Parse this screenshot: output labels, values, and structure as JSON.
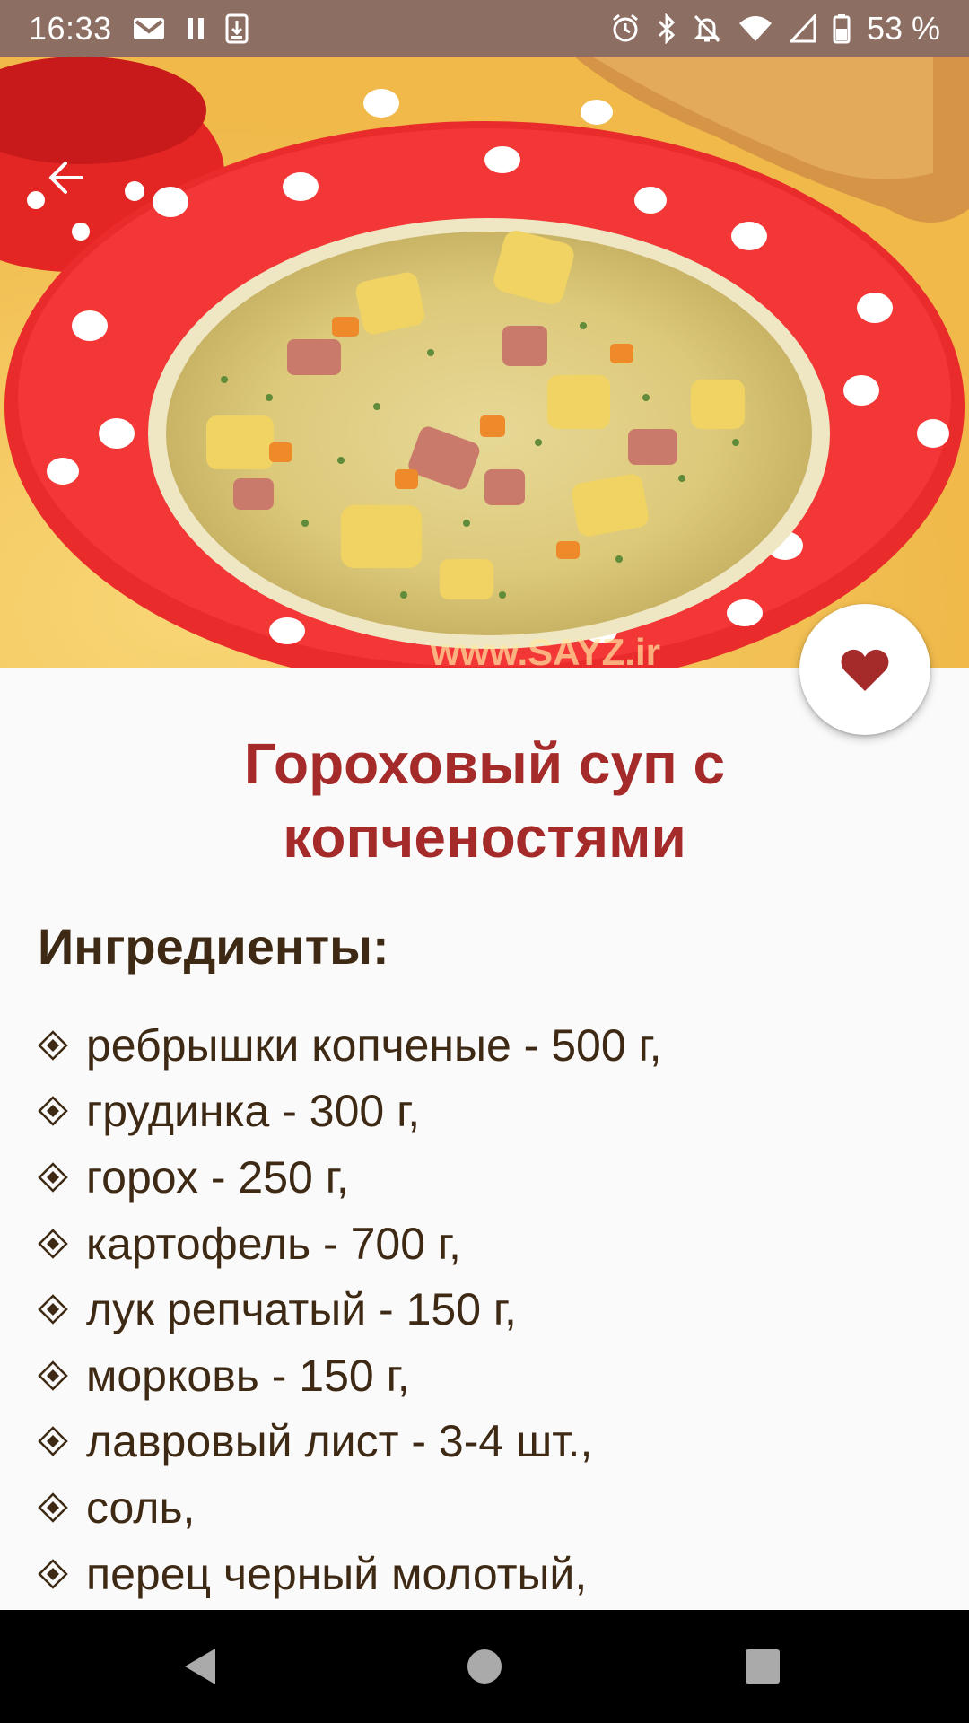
{
  "status_bar": {
    "time": "16:33",
    "battery_percent": "53 %",
    "icons": [
      "gmail-icon",
      "pause-icon",
      "download-icon",
      "alarm-icon",
      "bluetooth-icon",
      "dnd-off-icon",
      "wifi-icon",
      "signal-icon",
      "battery-icon"
    ]
  },
  "hero": {
    "image_description_icon": "pea-soup-photo",
    "back_icon": "arrow-back-icon",
    "watermark": "www.SAYZ.ir"
  },
  "favorite": {
    "icon": "heart-icon",
    "color": "#a52a2a"
  },
  "recipe": {
    "title": "Гороховый суп с копченостями",
    "ingredients_heading": "Ингредиенты:",
    "ingredients": [
      "ребрышки копченые - 500 г,",
      "грудинка - 300 г,",
      "горох - 250 г,",
      "картофель - 700 г,",
      "лук репчатый - 150 г,",
      "морковь - 150 г,",
      "лавровый лист - 3-4 шт.,",
      "соль,",
      "перец черный молотый,"
    ]
  },
  "nav": {
    "back": "nav-back-icon",
    "home": "nav-home-icon",
    "recents": "nav-recents-icon"
  },
  "colors": {
    "accent": "#a52a2a",
    "status_bar": "#8d6e63",
    "text_brown": "#3e2a14"
  }
}
